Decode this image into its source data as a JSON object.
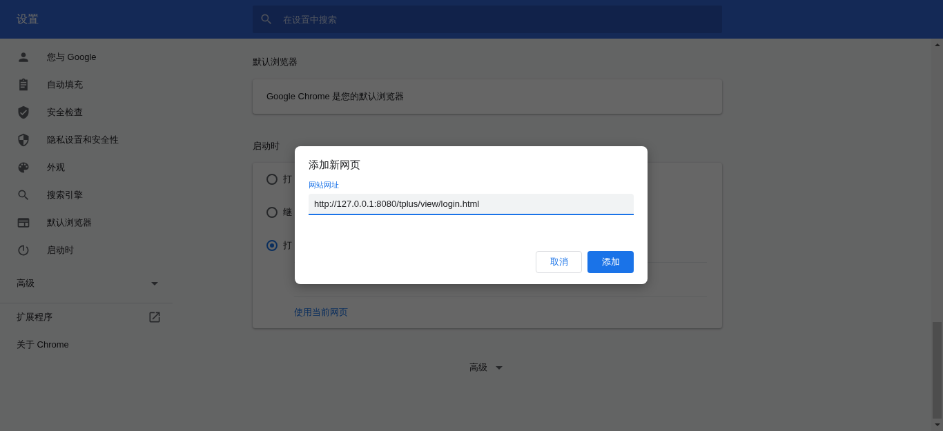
{
  "header": {
    "title": "设置",
    "search": {
      "placeholder": "在设置中搜索"
    }
  },
  "sidebar": {
    "items": [
      {
        "label": "您与 Google"
      },
      {
        "label": "自动填充"
      },
      {
        "label": "安全检查"
      },
      {
        "label": "隐私设置和安全性"
      },
      {
        "label": "外观"
      },
      {
        "label": "搜索引擎"
      },
      {
        "label": "默认浏览器"
      },
      {
        "label": "启动时"
      }
    ],
    "advanced": {
      "label": "高级",
      "expanded": false
    },
    "links": [
      {
        "label": "扩展程序",
        "kind": "external"
      },
      {
        "label": "关于 Chrome",
        "kind": "plain"
      }
    ]
  },
  "default_browser": {
    "heading": "默认浏览器",
    "text": "Google Chrome 是您的默认浏览器"
  },
  "on_startup": {
    "heading": "启动时",
    "options": [
      {
        "label": "打",
        "selected": false
      },
      {
        "label": "继",
        "selected": false
      },
      {
        "label": "打",
        "selected": true
      }
    ],
    "link": "使用当前网页"
  },
  "advanced_button": {
    "label": "高级",
    "expanded": false
  },
  "dialog": {
    "title": "添加新网页",
    "field_label": "网站网址",
    "value": "http://127.0.0.1:8080/tplus/view/login.html",
    "buttons": [
      {
        "label": "取消",
        "kind": "secondary"
      },
      {
        "label": "添加",
        "kind": "primary"
      }
    ]
  }
}
